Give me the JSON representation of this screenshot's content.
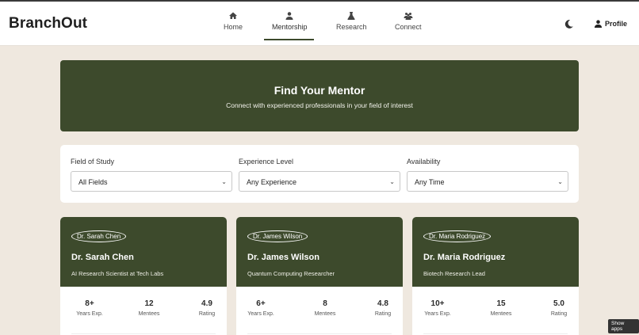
{
  "app": {
    "logo": "BranchOut"
  },
  "nav": [
    {
      "label": "Home",
      "icon": "home-icon"
    },
    {
      "label": "Mentorship",
      "icon": "person-icon",
      "active": true
    },
    {
      "label": "Research",
      "icon": "flask-icon"
    },
    {
      "label": "Connect",
      "icon": "people-icon"
    }
  ],
  "header_actions": {
    "theme_icon": "moon-icon",
    "profile_label": "Profile",
    "profile_icon": "user-icon"
  },
  "hero": {
    "title": "Find Your Mentor",
    "subtitle": "Connect with experienced professionals in your field of interest"
  },
  "filters": [
    {
      "label": "Field of Study",
      "value": "All Fields"
    },
    {
      "label": "Experience Level",
      "value": "Any Experience"
    },
    {
      "label": "Availability",
      "value": "Any Time"
    }
  ],
  "mentors": [
    {
      "image_alt": "Dr. Sarah Chen",
      "name": "Dr. Sarah Chen",
      "role": "AI Research Scientist at Tech Labs",
      "stats": [
        {
          "value": "8+",
          "label": "Years Exp."
        },
        {
          "value": "12",
          "label": "Mentees"
        },
        {
          "value": "4.9",
          "label": "Rating"
        }
      ]
    },
    {
      "image_alt": "Dr. James Wilson",
      "name": "Dr. James Wilson",
      "role": "Quantum Computing Researcher",
      "stats": [
        {
          "value": "6+",
          "label": "Years Exp."
        },
        {
          "value": "8",
          "label": "Mentees"
        },
        {
          "value": "4.8",
          "label": "Rating"
        }
      ]
    },
    {
      "image_alt": "Dr. Maria Rodriguez",
      "name": "Dr. Maria Rodriguez",
      "role": "Biotech Research Lead",
      "stats": [
        {
          "value": "10+",
          "label": "Years Exp."
        },
        {
          "value": "15",
          "label": "Mentees"
        },
        {
          "value": "5.0",
          "label": "Rating"
        }
      ]
    }
  ],
  "overlay": {
    "show_apps": "Show apps"
  },
  "colors": {
    "accent": "#3d4a2c",
    "background": "#efe8df"
  }
}
